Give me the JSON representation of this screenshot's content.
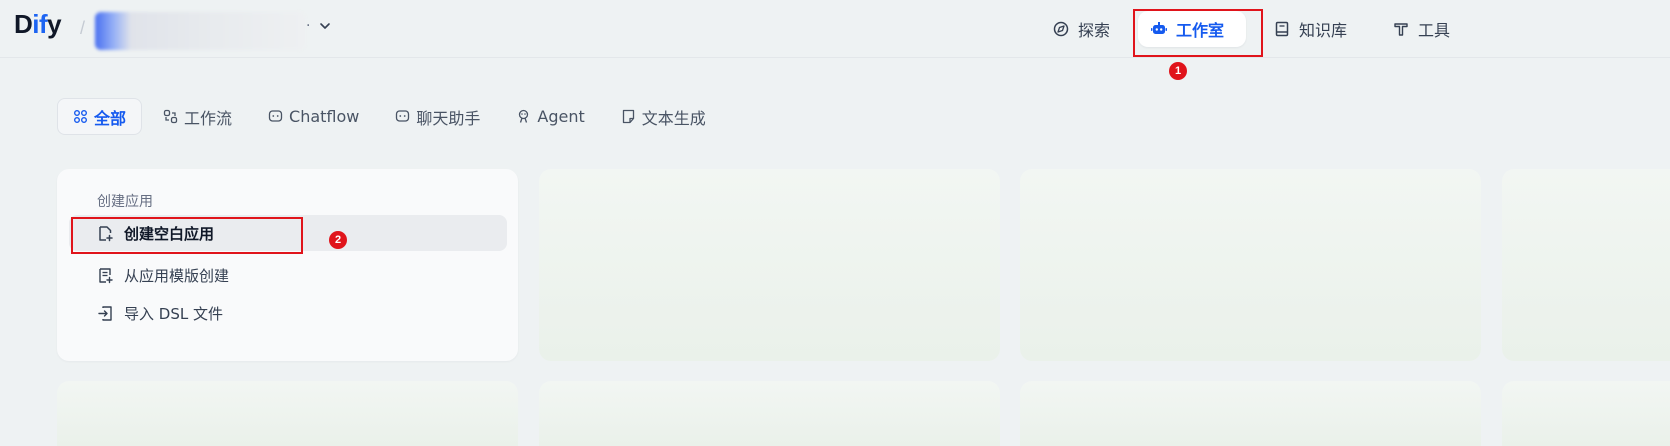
{
  "app": {
    "logo_prefix": "D",
    "logo_accent": "if",
    "logo_suffix": "y",
    "separator": "/",
    "workspace_dot": "·"
  },
  "nav": {
    "explore": "探索",
    "studio": "工作室",
    "knowledge": "知识库",
    "tools": "工具"
  },
  "tabs": [
    {
      "label": "全部",
      "icon": "grid-icon",
      "active": true
    },
    {
      "label": "工作流",
      "icon": "workflow-icon",
      "active": false
    },
    {
      "label": "Chatflow",
      "icon": "chat-bubble-icon",
      "active": false
    },
    {
      "label": "聊天助手",
      "icon": "chat-bubble-icon",
      "active": false
    },
    {
      "label": "Agent",
      "icon": "agent-icon",
      "active": false
    },
    {
      "label": "文本生成",
      "icon": "note-icon",
      "active": false
    }
  ],
  "create_card": {
    "title": "创建应用",
    "items": [
      {
        "label": "创建空白应用",
        "icon": "file-plus-icon"
      },
      {
        "label": "从应用模版创建",
        "icon": "template-icon"
      },
      {
        "label": "导入 DSL 文件",
        "icon": "import-icon"
      }
    ]
  },
  "callouts": [
    "1",
    "2"
  ],
  "colors": {
    "accent": "#155aef",
    "callout": "#e0141b",
    "background": "#eef2f3"
  }
}
